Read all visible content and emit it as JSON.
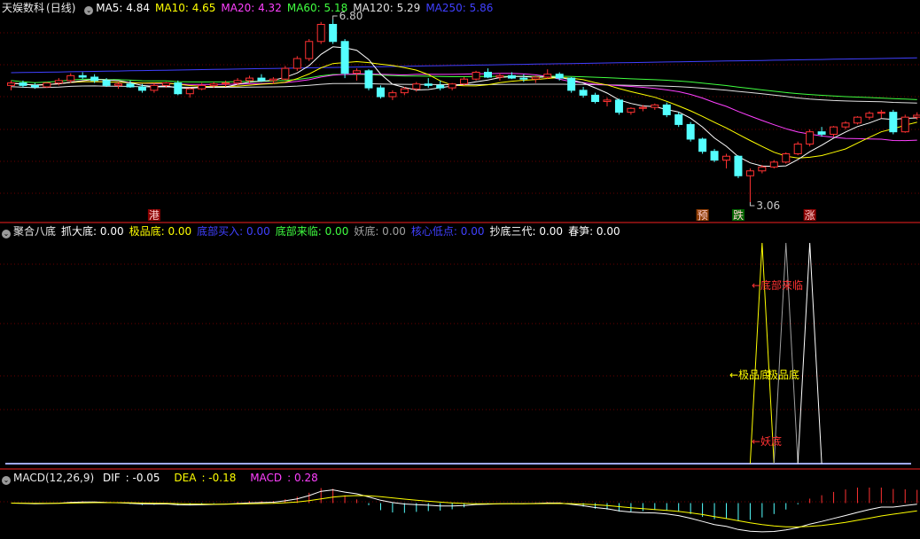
{
  "panel_main": {
    "stock_name": "天娱数科",
    "period": "(日线)",
    "ma": [
      {
        "label": "MA5",
        "value": "4.84",
        "color": "#ffffff"
      },
      {
        "label": "MA10",
        "value": "4.65",
        "color": "#ffff00"
      },
      {
        "label": "MA20",
        "value": "4.32",
        "color": "#ff40ff"
      },
      {
        "label": "MA60",
        "value": "5.18",
        "color": "#40ff40"
      },
      {
        "label": "MA120",
        "value": "5.29",
        "color": "#e0e0e0"
      },
      {
        "label": "MA250",
        "value": "5.86",
        "color": "#4040ff"
      }
    ],
    "high_label": "6.80",
    "low_label": "3.06",
    "markers": [
      "港",
      "预",
      "跌",
      "涨"
    ]
  },
  "panel_indicator": {
    "name": "聚合八底",
    "items": [
      {
        "label": "抓大底",
        "value": "0.00",
        "color": "#ffffff"
      },
      {
        "label": "极品底",
        "value": "0.00",
        "color": "#ffff00"
      },
      {
        "label": "底部买入",
        "value": "0.00",
        "color": "#4040ff"
      },
      {
        "label": "底部来临",
        "value": "0.00",
        "color": "#40ff40"
      },
      {
        "label": "妖底",
        "value": "0.00",
        "color": "#a0a0a0"
      },
      {
        "label": "核心低点",
        "value": "0.00",
        "color": "#4040ff"
      },
      {
        "label": "抄底三代",
        "value": "0.00",
        "color": "#ffffff"
      },
      {
        "label": "春笋",
        "value": "0.00",
        "color": "#ffffff"
      }
    ],
    "annotations": [
      "←底部来临",
      "←极品底",
      "极品底",
      "←妖底"
    ]
  },
  "panel_macd": {
    "name": "MACD(12,26,9)",
    "dif": {
      "label": "DIF",
      "value": "-0.05",
      "color": "#ffffff"
    },
    "dea": {
      "label": "DEA",
      "value": "-0.18",
      "color": "#ffff00"
    },
    "macd": {
      "label": "MACD",
      "value": "0.28",
      "color": "#ff40ff"
    }
  },
  "chart_data": {
    "type": "candlestick",
    "candles": [
      [
        5.45,
        5.55,
        5.35,
        5.5
      ],
      [
        5.5,
        5.55,
        5.4,
        5.45
      ],
      [
        5.45,
        5.5,
        5.38,
        5.42
      ],
      [
        5.42,
        5.52,
        5.4,
        5.5
      ],
      [
        5.5,
        5.6,
        5.45,
        5.55
      ],
      [
        5.55,
        5.7,
        5.5,
        5.65
      ],
      [
        5.65,
        5.72,
        5.58,
        5.62
      ],
      [
        5.62,
        5.68,
        5.5,
        5.55
      ],
      [
        5.55,
        5.6,
        5.42,
        5.45
      ],
      [
        5.45,
        5.52,
        5.38,
        5.48
      ],
      [
        5.48,
        5.55,
        5.4,
        5.42
      ],
      [
        5.42,
        5.48,
        5.3,
        5.35
      ],
      [
        5.35,
        5.5,
        5.3,
        5.45
      ],
      [
        5.45,
        5.52,
        5.4,
        5.5
      ],
      [
        5.5,
        5.55,
        5.25,
        5.28
      ],
      [
        5.28,
        5.4,
        5.2,
        5.38
      ],
      [
        5.38,
        5.5,
        5.35,
        5.45
      ],
      [
        5.45,
        5.52,
        5.4,
        5.48
      ],
      [
        5.48,
        5.55,
        5.42,
        5.5
      ],
      [
        5.5,
        5.6,
        5.45,
        5.55
      ],
      [
        5.55,
        5.65,
        5.5,
        5.6
      ],
      [
        5.6,
        5.68,
        5.52,
        5.55
      ],
      [
        5.55,
        5.62,
        5.48,
        5.58
      ],
      [
        5.58,
        5.85,
        5.55,
        5.8
      ],
      [
        5.8,
        6.05,
        5.75,
        6.0
      ],
      [
        6.0,
        6.4,
        5.95,
        6.35
      ],
      [
        6.35,
        6.75,
        6.3,
        6.7
      ],
      [
        6.7,
        6.8,
        6.3,
        6.35
      ],
      [
        6.35,
        6.4,
        5.6,
        5.7
      ],
      [
        5.7,
        5.8,
        5.55,
        5.75
      ],
      [
        5.75,
        5.78,
        5.35,
        5.4
      ],
      [
        5.4,
        5.45,
        5.18,
        5.22
      ],
      [
        5.22,
        5.35,
        5.15,
        5.3
      ],
      [
        5.3,
        5.42,
        5.25,
        5.38
      ],
      [
        5.38,
        5.52,
        5.32,
        5.48
      ],
      [
        5.48,
        5.6,
        5.4,
        5.45
      ],
      [
        5.45,
        5.55,
        5.35,
        5.4
      ],
      [
        5.4,
        5.5,
        5.35,
        5.48
      ],
      [
        5.48,
        5.62,
        5.45,
        5.58
      ],
      [
        5.58,
        5.75,
        5.55,
        5.72
      ],
      [
        5.72,
        5.8,
        5.6,
        5.62
      ],
      [
        5.62,
        5.7,
        5.55,
        5.65
      ],
      [
        5.65,
        5.72,
        5.58,
        5.6
      ],
      [
        5.6,
        5.68,
        5.52,
        5.58
      ],
      [
        5.58,
        5.65,
        5.5,
        5.62
      ],
      [
        5.62,
        5.78,
        5.58,
        5.68
      ],
      [
        5.68,
        5.72,
        5.55,
        5.6
      ],
      [
        5.6,
        5.62,
        5.3,
        5.35
      ],
      [
        5.35,
        5.42,
        5.2,
        5.25
      ],
      [
        5.25,
        5.3,
        5.08,
        5.12
      ],
      [
        5.12,
        5.2,
        5.02,
        5.15
      ],
      [
        5.15,
        5.18,
        4.85,
        4.9
      ],
      [
        4.9,
        5.0,
        4.85,
        4.98
      ],
      [
        4.98,
        5.05,
        4.92,
        5.0
      ],
      [
        5.0,
        5.08,
        4.95,
        5.05
      ],
      [
        5.05,
        5.1,
        4.8,
        4.85
      ],
      [
        4.85,
        4.9,
        4.6,
        4.65
      ],
      [
        4.65,
        4.7,
        4.3,
        4.35
      ],
      [
        4.35,
        4.38,
        4.05,
        4.1
      ],
      [
        4.1,
        4.15,
        3.88,
        3.92
      ],
      [
        3.92,
        4.05,
        3.75,
        4.0
      ],
      [
        4.0,
        4.02,
        3.55,
        3.6
      ],
      [
        3.6,
        3.75,
        3.06,
        3.7
      ],
      [
        3.7,
        3.82,
        3.65,
        3.78
      ],
      [
        3.78,
        3.92,
        3.75,
        3.88
      ],
      [
        3.88,
        4.08,
        3.85,
        4.05
      ],
      [
        4.05,
        4.3,
        4.02,
        4.25
      ],
      [
        4.25,
        4.55,
        4.2,
        4.5
      ],
      [
        4.5,
        4.6,
        4.4,
        4.45
      ],
      [
        4.45,
        4.62,
        4.4,
        4.6
      ],
      [
        4.6,
        4.72,
        4.55,
        4.68
      ],
      [
        4.68,
        4.82,
        4.65,
        4.8
      ],
      [
        4.8,
        4.92,
        4.75,
        4.88
      ],
      [
        4.88,
        4.95,
        4.78,
        4.9
      ],
      [
        4.9,
        4.95,
        4.45,
        4.5
      ],
      [
        4.5,
        4.85,
        4.48,
        4.8
      ],
      [
        4.8,
        4.9,
        4.75,
        4.84
      ]
    ],
    "ma250_level": 5.86,
    "price_range": [
      3.06,
      6.8
    ],
    "signal_peaks": {
      "yellow": [
        62,
        64
      ],
      "gray": [
        64,
        66
      ],
      "white": [
        66,
        68
      ]
    },
    "macd_range": [
      -0.55,
      0.25
    ]
  }
}
